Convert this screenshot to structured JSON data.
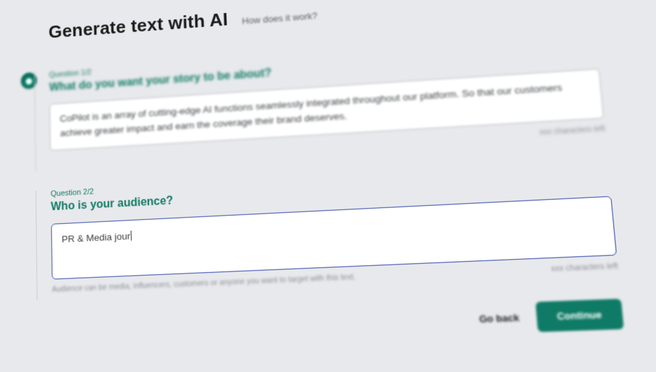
{
  "header": {
    "title": "Generate text with AI",
    "how_link": "How does it work?"
  },
  "question1": {
    "meta": "Question 1/2",
    "title": "What do you want your story to be about?",
    "value": "CoPilot is an array of cutting-edge AI functions seamlessly integrated throughout our platform. So that our customers achieve greater impact and earn the coverage their brand deserves.",
    "char_hint": "xxx characters left"
  },
  "question2": {
    "meta": "Question 2/2",
    "title": "Who is your audience?",
    "value": "PR & Media jour",
    "help_hint": "Audience can be media, influencers, customers or anyone you want to target with this text.",
    "char_hint": "xxx characters left"
  },
  "footer": {
    "back_label": "Go back",
    "continue_label": "Continue"
  }
}
